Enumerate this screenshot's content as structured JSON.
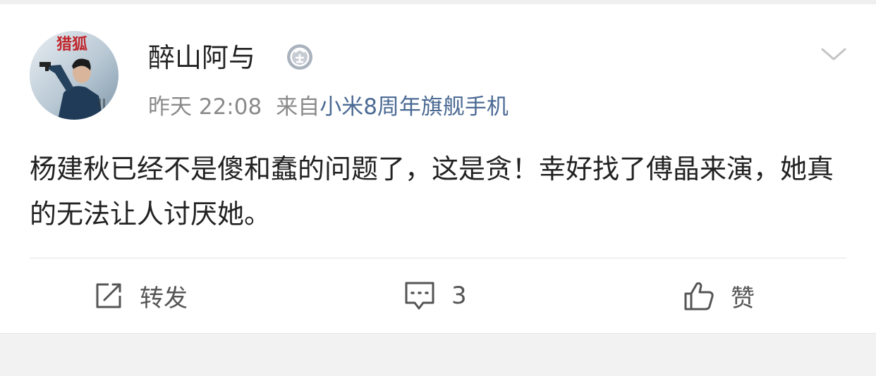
{
  "post": {
    "username": "醉山阿与",
    "badge_icon": "medal-badge-icon",
    "time": "昨天 22:08",
    "source_prefix": "来自",
    "source_name": "小米8周年旗舰手机",
    "text": "杨建秋已经不是傻和蠢的问题了，这是贪！幸好找了傅晶来演，她真的无法让人讨厌她。",
    "avatar": {
      "poster_title": "猎狐",
      "icon": "avatar-image"
    }
  },
  "actions": {
    "repost_label": "转发",
    "comment_count": "3",
    "like_label": "赞"
  },
  "colors": {
    "link": "#4b6a94",
    "meta_gray": "#8a8a8a",
    "text": "#222222",
    "background": "#f2f2f2"
  }
}
